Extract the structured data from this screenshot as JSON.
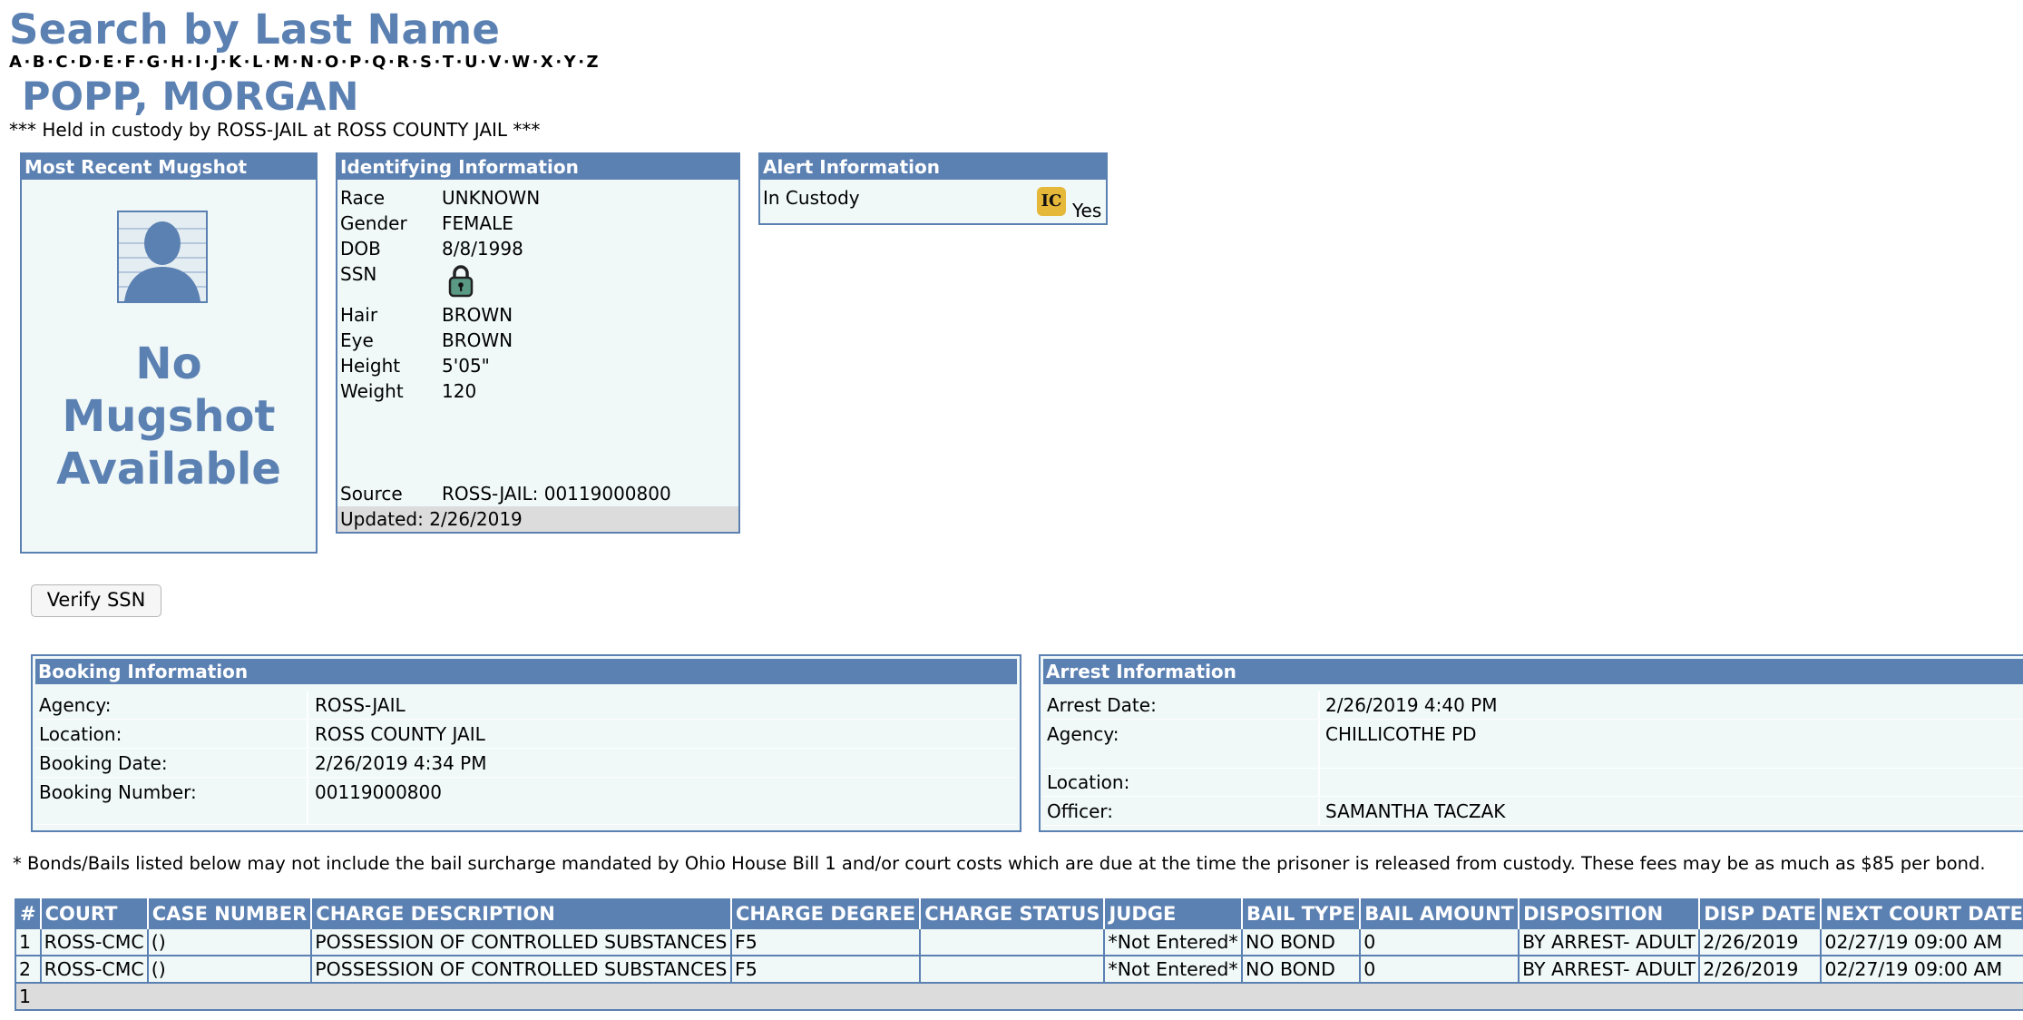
{
  "header": {
    "title": "Search by Last Name",
    "alphabet": [
      "A",
      "B",
      "C",
      "D",
      "E",
      "F",
      "G",
      "H",
      "I",
      "J",
      "K",
      "L",
      "M",
      "N",
      "O",
      "P",
      "Q",
      "R",
      "S",
      "T",
      "U",
      "V",
      "W",
      "X",
      "Y",
      "Z"
    ],
    "name": "POPP, MORGAN",
    "custody_notice": "*** Held in custody by ROSS-JAIL at ROSS COUNTY JAIL ***"
  },
  "mugshot": {
    "heading": "Most Recent Mugshot",
    "no_mug_lines": [
      "No",
      "Mugshot",
      "Available"
    ],
    "icon": "person-silhouette-icon"
  },
  "identifying": {
    "heading": "Identifying Information",
    "rows": [
      {
        "label": "Race",
        "value": "UNKNOWN"
      },
      {
        "label": "Gender",
        "value": "FEMALE"
      },
      {
        "label": "DOB",
        "value": "8/8/1998"
      },
      {
        "label": "SSN",
        "value": ""
      },
      {
        "label": "Hair",
        "value": "BROWN"
      },
      {
        "label": "Eye",
        "value": "BROWN"
      },
      {
        "label": "Height",
        "value": "5'05\""
      },
      {
        "label": "Weight",
        "value": "120"
      }
    ],
    "ssn_icon": "padlock-icon",
    "source_label": "Source",
    "source_value": "ROSS-JAIL: 00119000800",
    "updated": "Updated: 2/26/2019"
  },
  "alert": {
    "heading": "Alert Information",
    "label": "In Custody",
    "badge": "IC",
    "value": "Yes",
    "badge_color": "#e6b83a"
  },
  "verify_button": "Verify SSN",
  "booking": {
    "heading": "Booking Information",
    "rows": [
      {
        "label": "Agency:",
        "value": "ROSS-JAIL"
      },
      {
        "label": "Location:",
        "value": "ROSS COUNTY JAIL"
      },
      {
        "label": "Booking Date:",
        "value": "2/26/2019 4:34 PM"
      },
      {
        "label": "Booking Number:",
        "value": "00119000800"
      }
    ]
  },
  "arrest": {
    "heading": "Arrest Information",
    "rows": [
      {
        "label": "Arrest Date:",
        "value": "2/26/2019 4:40 PM"
      },
      {
        "label": "Agency:",
        "value": "CHILLICOTHE PD"
      },
      {
        "label": "Location:",
        "value": ""
      },
      {
        "label": "Officer:",
        "value": "SAMANTHA TACZAK"
      }
    ]
  },
  "bond_note": "* Bonds/Bails listed below may not include the bail surcharge mandated by Ohio House Bill 1 and/or court costs which are due at the time the prisoner is released from custody. These fees may be as much as $85 per bond.",
  "charges": {
    "columns": [
      "#",
      "COURT",
      "CASE NUMBER",
      "CHARGE DESCRIPTION",
      "CHARGE DEGREE",
      "CHARGE STATUS",
      "JUDGE",
      "BAIL TYPE",
      "BAIL AMOUNT",
      "DISPOSITION",
      "DISP DATE",
      "NEXT COURT DATE"
    ],
    "rows": [
      [
        "1",
        "ROSS-CMC",
        "()",
        "POSSESSION OF CONTROLLED SUBSTANCES",
        "F5",
        "",
        "*Not Entered*",
        "NO BOND",
        "0",
        "BY ARREST- ADULT",
        "2/26/2019",
        "02/27/19 09:00 AM"
      ],
      [
        "2",
        "ROSS-CMC",
        "()",
        "POSSESSION OF CONTROLLED SUBSTANCES",
        "F5",
        "",
        "*Not Entered*",
        "NO BOND",
        "0",
        "BY ARREST- ADULT",
        "2/26/2019",
        "02/27/19 09:00 AM"
      ]
    ],
    "footer": "1"
  }
}
